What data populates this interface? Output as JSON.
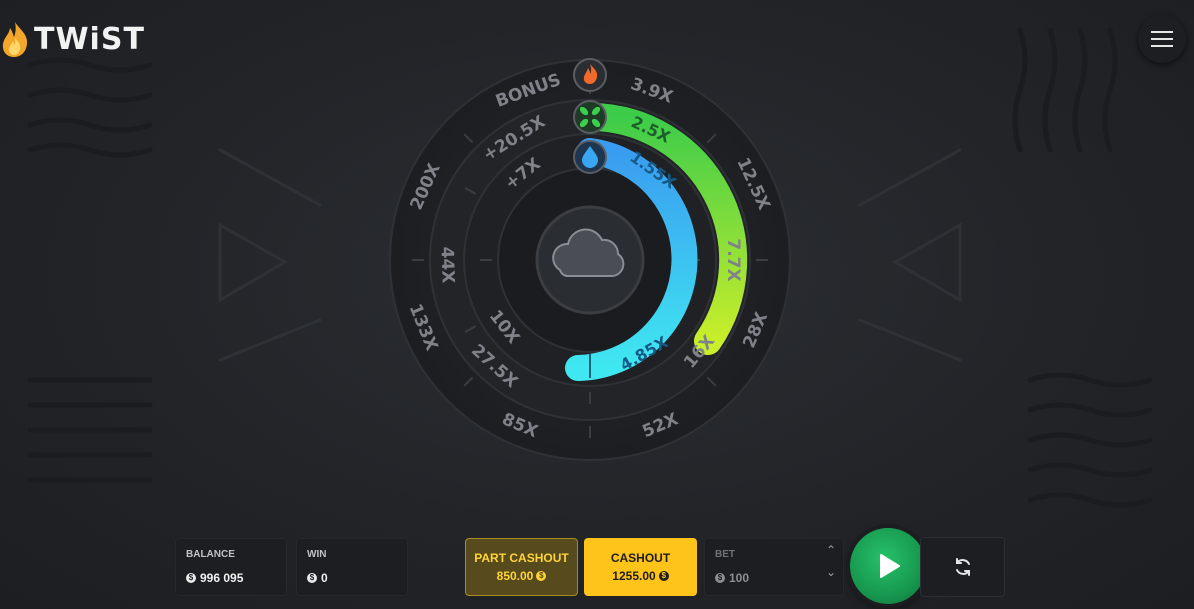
{
  "logo": {
    "text": "TWiST"
  },
  "wheel": {
    "outer_labels": [
      "BONUS",
      "3.9X",
      "12.5X",
      "28X",
      "52X",
      "85X",
      "133X",
      "200X"
    ],
    "middle_labels": [
      "+20.5X",
      "7.7X",
      "16X",
      "27.5X",
      "44X"
    ],
    "inner_labels": [
      "+7X",
      "10X"
    ],
    "green_bar_labels": [
      "2.5X"
    ],
    "blue_bar_labels": [
      "1.55X",
      "4.85X"
    ]
  },
  "balance": {
    "label": "BALANCE",
    "value": "996 095",
    "currency_symbol": "$"
  },
  "win": {
    "label": "WIN",
    "value": "0",
    "currency_symbol": "$"
  },
  "part_cashout": {
    "label": "PART CASHOUT",
    "amount": "850.00",
    "currency_symbol": "$"
  },
  "cashout": {
    "label": "CASHOUT",
    "amount": "1255.00",
    "currency_symbol": "$"
  },
  "bet": {
    "label": "BET",
    "value": "100",
    "currency_symbol": "$"
  },
  "colors": {
    "accent_yellow": "#ffc419",
    "green_bar": "#9be12a",
    "blue_bar": "#3fb4f0",
    "play_green": "#17984f"
  },
  "icons": [
    "fire-icon",
    "leaf-icon",
    "water-drop-icon",
    "cloud-icon",
    "menu-icon",
    "play-icon",
    "refresh-icon",
    "chevron-up-icon",
    "chevron-down-icon"
  ]
}
